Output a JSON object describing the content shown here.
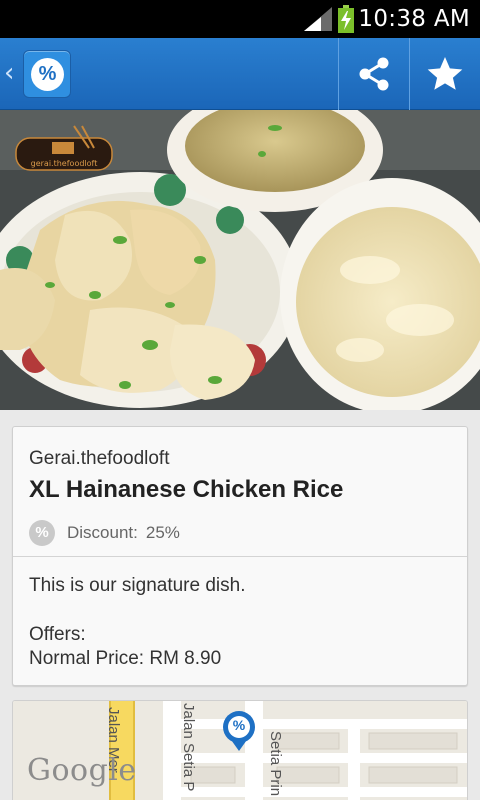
{
  "status_bar": {
    "time": "10:38 AM"
  },
  "action_bar": {
    "logo_symbol": "%",
    "share_icon": "share-icon",
    "star_icon": "star-icon"
  },
  "hero": {
    "shop_logo_text": "gerai.thefoodloft"
  },
  "deal": {
    "vendor": "Gerai.thefoodloft",
    "title": "XL Hainanese Chicken Rice",
    "discount_symbol": "%",
    "discount_label": "Discount:",
    "discount_value": "25%",
    "description": "This is our signature dish.",
    "offers_label": "Offers:",
    "price_line": "Normal Price: RM 8.90"
  },
  "map": {
    "attribution": "Google",
    "road_1": "Jalan Mer",
    "road_2": "Jalan Setia P",
    "road_3": "Setia Prin",
    "pin_symbol": "%"
  },
  "colors": {
    "action_bar": "#1e70c4",
    "card_bg": "#f9f9f9",
    "page_bg": "#e9e9e9"
  }
}
